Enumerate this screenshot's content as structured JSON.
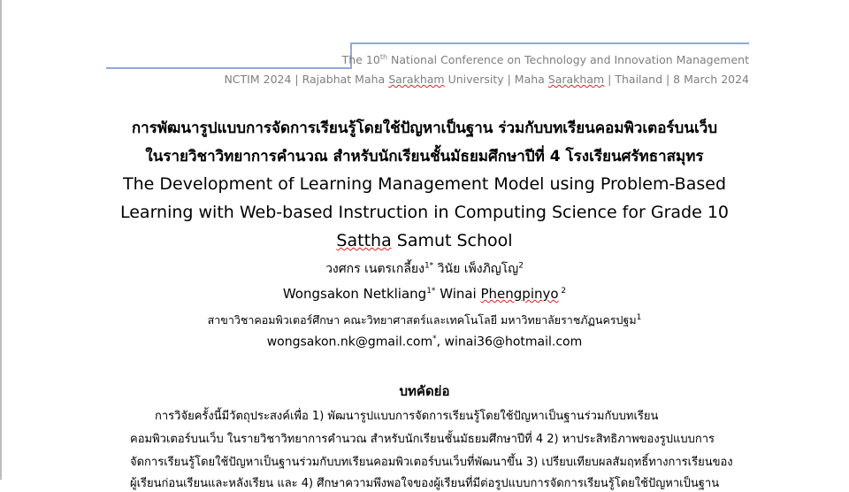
{
  "header": {
    "conference_prefix": "The 10",
    "conference_sup": "th",
    "conference_suffix": " National Conference on Technology and Innovation Management",
    "subtitle_parts": {
      "a": "NCTIM 2024 | Rajabhat Maha ",
      "b": "Sarakham",
      "c": " University | Maha ",
      "d": "Sarakham",
      "e": " | Thailand | 8 March 2024"
    }
  },
  "title": {
    "thai_line1": "การพัฒนารูปแบบการจัดการเรียนรู้โดยใช้ปัญหาเป็นฐาน ร่วมกับบทเรียนคอมพิวเตอร์บนเว็บ",
    "thai_line2": "ในรายวิชาวิทยาการคำนวณ สำหรับนักเรียนชั้นมัธยมศึกษาปีที่ 4 โรงเรียนศรัทธาสมุทร",
    "english_line1": "The Development of Learning Management Model using Problem-Based",
    "english_line2": "Learning with Web-based Instruction in Computing Science for Grade 10",
    "english_line3_a": "Sattha",
    "english_line3_b": " Samut School"
  },
  "authors": {
    "thai_author1": "วงศกร เนตรเกลี้ยง",
    "thai_author1_sup": "1*",
    "thai_author2": " วินัย เพ็งภิญโญ",
    "thai_author2_sup": "2",
    "en_author1": "Wongsakon Netkliang",
    "en_author1_sup": "1*",
    "en_author2_a": " Winai ",
    "en_author2_b": "Phengpinyo",
    "en_author2_sup": " 2"
  },
  "affiliation": {
    "text": "สาขาวิชาคอมพิวเตอร์ศึกษา คณะวิทยาศาสตร์และเทคโนโลยี มหาวิทยาลัยราชภัฏนครปฐม",
    "sup": "1"
  },
  "emails": {
    "email1": "wongsakon.nk@gmail.com",
    "email1_sup": "*",
    "email2": ", winai36@hotmail.com"
  },
  "abstract": {
    "heading": "บทคัดย่อ",
    "lines": [
      "การวิจัยครั้งนี้มีวัตถุประสงค์เพื่อ 1) พัฒนารูปแบบการจัดการเรียนรู้โดยใช้ปัญหาเป็นฐานร่วมกับบทเรียน",
      "คอมพิวเตอร์บนเว็บ ในรายวิชาวิทยาการคำนวณ สำหรับนักเรียนชั้นมัธยมศึกษาปีที่ 4 2) หาประสิทธิภาพของรูปแบบการ",
      "จัดการเรียนรู้โดยใช้ปัญหาเป็นฐานร่วมกับบทเรียนคอมพิวเตอร์บนเว็บที่พัฒนาขึ้น 3) เปรียบเทียบผลสัมฤทธิ์ทางการเรียนของ",
      "ผู้เรียนก่อนเรียนและหลังเรียน และ 4) ศึกษาความพึงพอใจของผู้เรียนที่มีต่อรูปแบบการจัดการเรียนรู้โดยใช้ปัญหาเป็นฐาน"
    ]
  }
}
